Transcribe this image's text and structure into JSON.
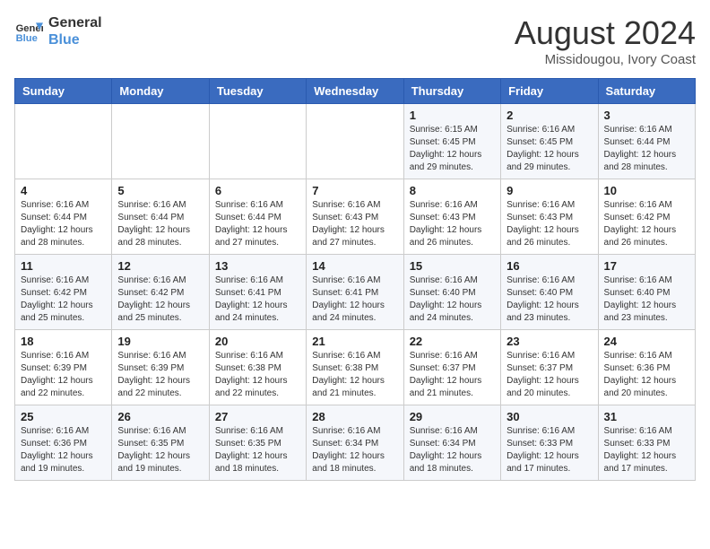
{
  "header": {
    "logo_line1": "General",
    "logo_line2": "Blue",
    "month": "August 2024",
    "location": "Missidougou, Ivory Coast"
  },
  "weekdays": [
    "Sunday",
    "Monday",
    "Tuesday",
    "Wednesday",
    "Thursday",
    "Friday",
    "Saturday"
  ],
  "weeks": [
    [
      {
        "day": "",
        "info": ""
      },
      {
        "day": "",
        "info": ""
      },
      {
        "day": "",
        "info": ""
      },
      {
        "day": "",
        "info": ""
      },
      {
        "day": "1",
        "info": "Sunrise: 6:15 AM\nSunset: 6:45 PM\nDaylight: 12 hours\nand 29 minutes."
      },
      {
        "day": "2",
        "info": "Sunrise: 6:16 AM\nSunset: 6:45 PM\nDaylight: 12 hours\nand 29 minutes."
      },
      {
        "day": "3",
        "info": "Sunrise: 6:16 AM\nSunset: 6:44 PM\nDaylight: 12 hours\nand 28 minutes."
      }
    ],
    [
      {
        "day": "4",
        "info": "Sunrise: 6:16 AM\nSunset: 6:44 PM\nDaylight: 12 hours\nand 28 minutes."
      },
      {
        "day": "5",
        "info": "Sunrise: 6:16 AM\nSunset: 6:44 PM\nDaylight: 12 hours\nand 28 minutes."
      },
      {
        "day": "6",
        "info": "Sunrise: 6:16 AM\nSunset: 6:44 PM\nDaylight: 12 hours\nand 27 minutes."
      },
      {
        "day": "7",
        "info": "Sunrise: 6:16 AM\nSunset: 6:43 PM\nDaylight: 12 hours\nand 27 minutes."
      },
      {
        "day": "8",
        "info": "Sunrise: 6:16 AM\nSunset: 6:43 PM\nDaylight: 12 hours\nand 26 minutes."
      },
      {
        "day": "9",
        "info": "Sunrise: 6:16 AM\nSunset: 6:43 PM\nDaylight: 12 hours\nand 26 minutes."
      },
      {
        "day": "10",
        "info": "Sunrise: 6:16 AM\nSunset: 6:42 PM\nDaylight: 12 hours\nand 26 minutes."
      }
    ],
    [
      {
        "day": "11",
        "info": "Sunrise: 6:16 AM\nSunset: 6:42 PM\nDaylight: 12 hours\nand 25 minutes."
      },
      {
        "day": "12",
        "info": "Sunrise: 6:16 AM\nSunset: 6:42 PM\nDaylight: 12 hours\nand 25 minutes."
      },
      {
        "day": "13",
        "info": "Sunrise: 6:16 AM\nSunset: 6:41 PM\nDaylight: 12 hours\nand 24 minutes."
      },
      {
        "day": "14",
        "info": "Sunrise: 6:16 AM\nSunset: 6:41 PM\nDaylight: 12 hours\nand 24 minutes."
      },
      {
        "day": "15",
        "info": "Sunrise: 6:16 AM\nSunset: 6:40 PM\nDaylight: 12 hours\nand 24 minutes."
      },
      {
        "day": "16",
        "info": "Sunrise: 6:16 AM\nSunset: 6:40 PM\nDaylight: 12 hours\nand 23 minutes."
      },
      {
        "day": "17",
        "info": "Sunrise: 6:16 AM\nSunset: 6:40 PM\nDaylight: 12 hours\nand 23 minutes."
      }
    ],
    [
      {
        "day": "18",
        "info": "Sunrise: 6:16 AM\nSunset: 6:39 PM\nDaylight: 12 hours\nand 22 minutes."
      },
      {
        "day": "19",
        "info": "Sunrise: 6:16 AM\nSunset: 6:39 PM\nDaylight: 12 hours\nand 22 minutes."
      },
      {
        "day": "20",
        "info": "Sunrise: 6:16 AM\nSunset: 6:38 PM\nDaylight: 12 hours\nand 22 minutes."
      },
      {
        "day": "21",
        "info": "Sunrise: 6:16 AM\nSunset: 6:38 PM\nDaylight: 12 hours\nand 21 minutes."
      },
      {
        "day": "22",
        "info": "Sunrise: 6:16 AM\nSunset: 6:37 PM\nDaylight: 12 hours\nand 21 minutes."
      },
      {
        "day": "23",
        "info": "Sunrise: 6:16 AM\nSunset: 6:37 PM\nDaylight: 12 hours\nand 20 minutes."
      },
      {
        "day": "24",
        "info": "Sunrise: 6:16 AM\nSunset: 6:36 PM\nDaylight: 12 hours\nand 20 minutes."
      }
    ],
    [
      {
        "day": "25",
        "info": "Sunrise: 6:16 AM\nSunset: 6:36 PM\nDaylight: 12 hours\nand 19 minutes."
      },
      {
        "day": "26",
        "info": "Sunrise: 6:16 AM\nSunset: 6:35 PM\nDaylight: 12 hours\nand 19 minutes."
      },
      {
        "day": "27",
        "info": "Sunrise: 6:16 AM\nSunset: 6:35 PM\nDaylight: 12 hours\nand 18 minutes."
      },
      {
        "day": "28",
        "info": "Sunrise: 6:16 AM\nSunset: 6:34 PM\nDaylight: 12 hours\nand 18 minutes."
      },
      {
        "day": "29",
        "info": "Sunrise: 6:16 AM\nSunset: 6:34 PM\nDaylight: 12 hours\nand 18 minutes."
      },
      {
        "day": "30",
        "info": "Sunrise: 6:16 AM\nSunset: 6:33 PM\nDaylight: 12 hours\nand 17 minutes."
      },
      {
        "day": "31",
        "info": "Sunrise: 6:16 AM\nSunset: 6:33 PM\nDaylight: 12 hours\nand 17 minutes."
      }
    ]
  ]
}
